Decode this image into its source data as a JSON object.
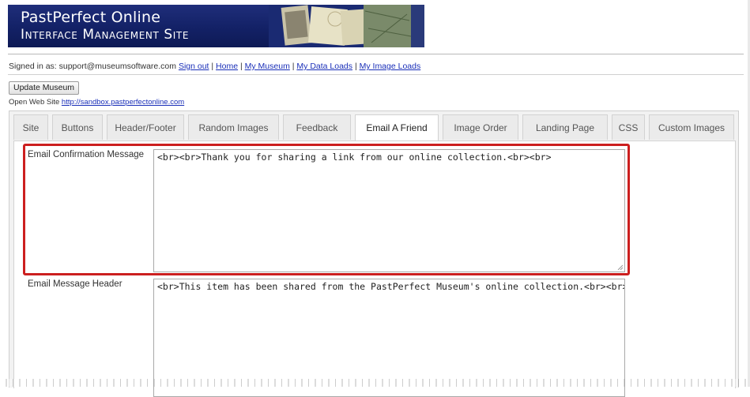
{
  "header": {
    "title_line1": "PastPerfect Online",
    "title_line2": "Interface Management Site"
  },
  "account": {
    "signed_in_prefix": "Signed in as: support@museumsoftware.com",
    "links": [
      "Sign out",
      "Home",
      "My Museum",
      "My Data Loads",
      "My Image Loads"
    ],
    "separator": "|"
  },
  "actions": {
    "update_label": "Update Museum",
    "open_site_label": "Open Web Site",
    "open_site_url": "http://sandbox.pastperfectonline.com"
  },
  "tabs": [
    {
      "label": "Site"
    },
    {
      "label": "Buttons"
    },
    {
      "label": "Header/Footer"
    },
    {
      "label": "Random Images"
    },
    {
      "label": "Feedback"
    },
    {
      "label": "Email A Friend"
    },
    {
      "label": "Image Order"
    },
    {
      "label": "Landing Page"
    },
    {
      "label": "CSS"
    },
    {
      "label": "Custom Images"
    }
  ],
  "active_tab": "Email A Friend",
  "form": {
    "confirmation_label": "Email Confirmation Message",
    "confirmation_value": "<br><br>Thank you for sharing a link from our online collection.<br><br>",
    "header_label": "Email Message Header",
    "header_value": "<br>This item has been shared from the PastPerfect Museum's online collection.<br><br>"
  },
  "colors": {
    "banner": "#132166",
    "highlight": "#cc1f1f",
    "link": "#1a2fb8"
  }
}
